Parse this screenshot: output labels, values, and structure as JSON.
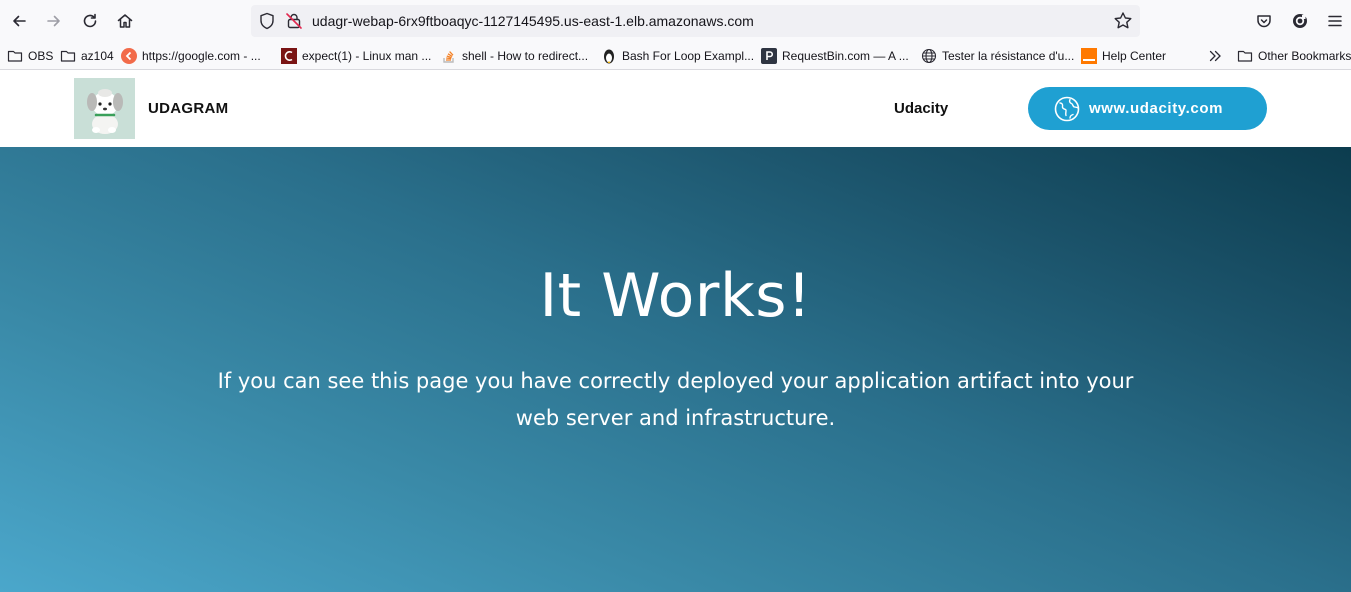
{
  "browser": {
    "url": "udagr-webap-6rx9ftboaqyc-1127145495.us-east-1.elb.amazonaws.com",
    "toolbar_icons": [
      "back-icon",
      "forward-icon",
      "reload-icon",
      "home-icon",
      "shield-icon",
      "insecure-lock-icon",
      "star-icon",
      "pocket-icon",
      "account-icon",
      "menu-icon"
    ]
  },
  "bookmarks": {
    "items": [
      {
        "label": "OBS",
        "icon": "folder-icon"
      },
      {
        "label": "az104",
        "icon": "folder-icon"
      },
      {
        "label": "https://google.com - ...",
        "icon": "site-icon"
      },
      {
        "label": "expect(1) - Linux man ...",
        "icon": "site-icon"
      },
      {
        "label": "shell - How to redirect...",
        "icon": "stackoverflow-icon"
      },
      {
        "label": "Bash For Loop Exampl...",
        "icon": "site-icon"
      },
      {
        "label": "RequestBin.com — A ...",
        "icon": "site-icon"
      },
      {
        "label": "Tester la résistance d'u...",
        "icon": "globe-icon"
      },
      {
        "label": "Help Center",
        "icon": "site-icon"
      }
    ],
    "other": "Other Bookmarks"
  },
  "header": {
    "brand": "UDAGRAM",
    "nav_link": "Udacity",
    "cta": "www.udacity.com"
  },
  "hero": {
    "title": "It Works!",
    "text": "If you can see this page you have correctly deployed your application artifact into your web server and infrastructure."
  },
  "colors": {
    "accent": "#1fa0d2",
    "hero_start": "#4ba7cb",
    "hero_end": "#0c3c4e"
  }
}
